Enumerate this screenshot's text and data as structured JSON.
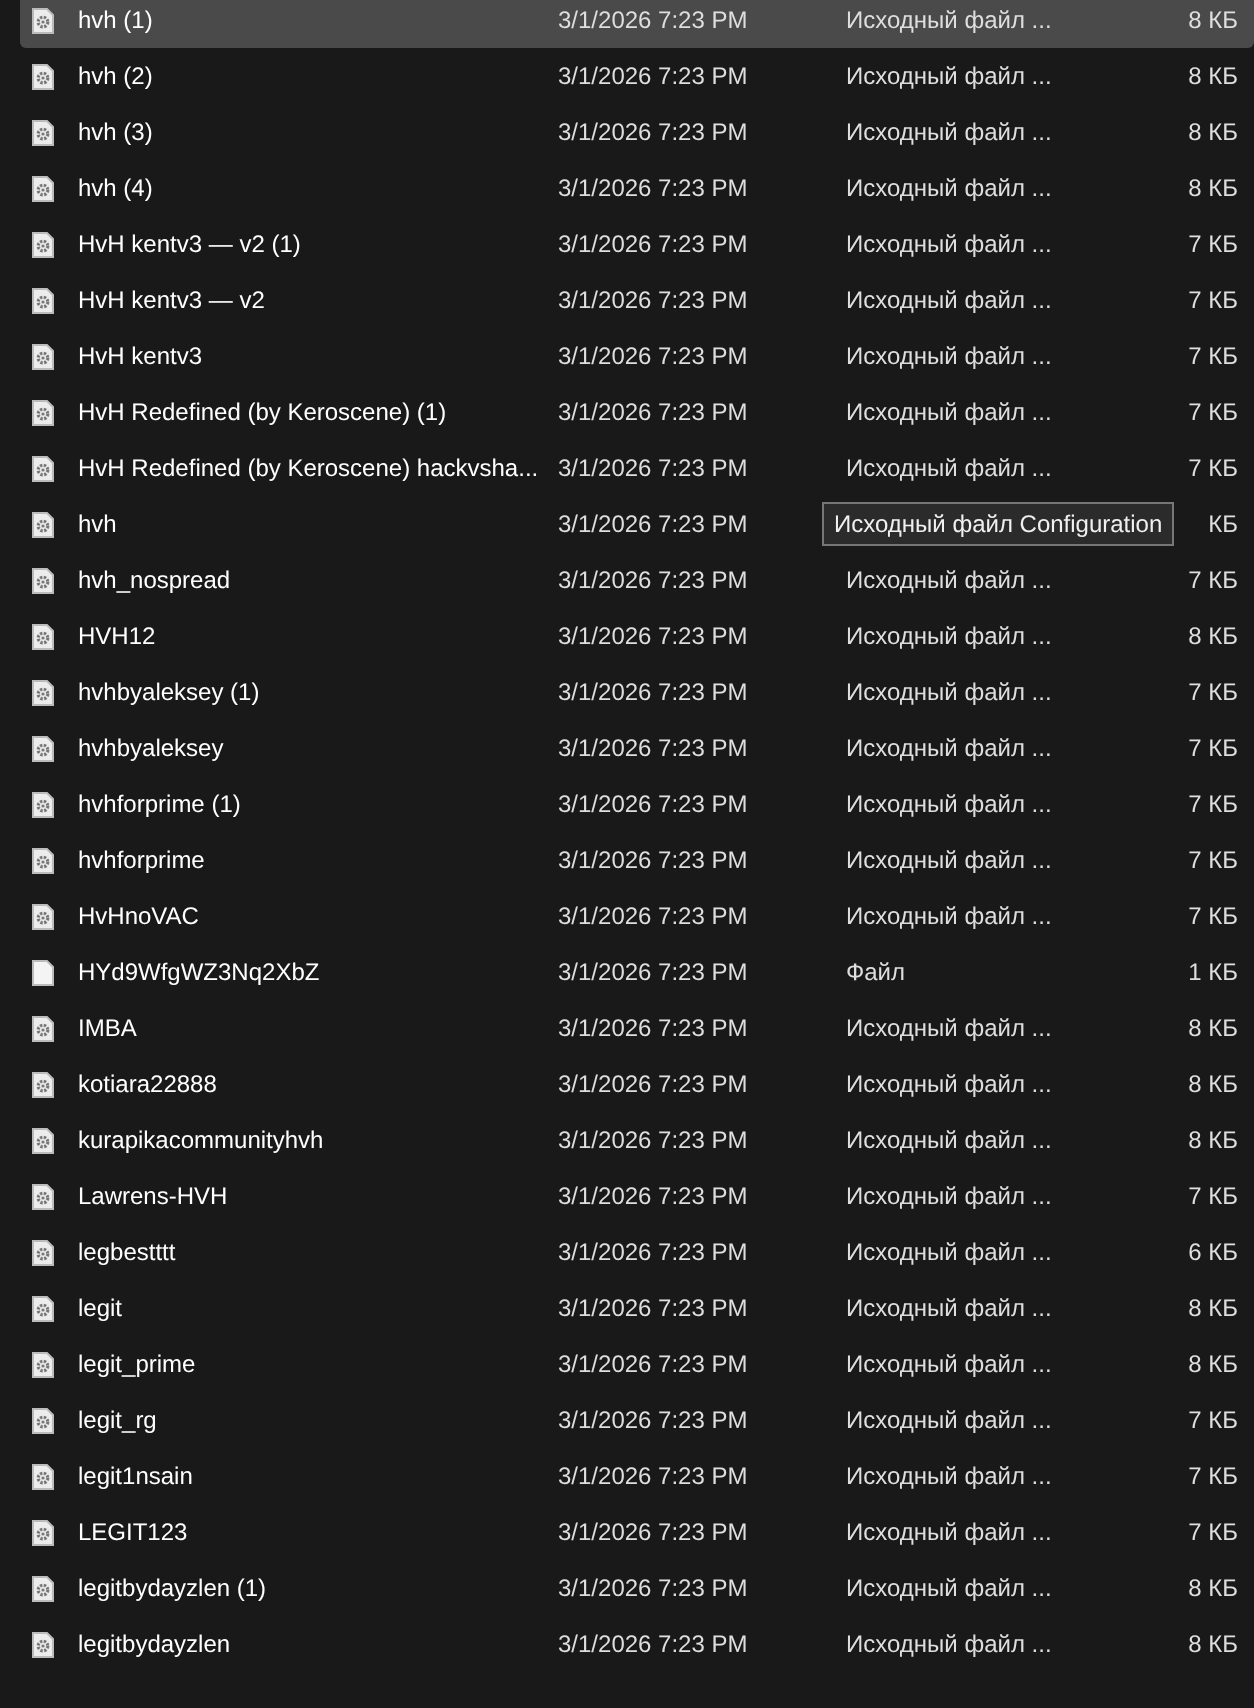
{
  "files": [
    {
      "kind": "config",
      "name": "hvh (1)",
      "date": "3/1/2026 7:23 PM",
      "type": "Исходный файл ...",
      "size": "8 КБ",
      "selected": true
    },
    {
      "kind": "config",
      "name": "hvh (2)",
      "date": "3/1/2026 7:23 PM",
      "type": "Исходный файл ...",
      "size": "8 КБ",
      "selected": false
    },
    {
      "kind": "config",
      "name": "hvh (3)",
      "date": "3/1/2026 7:23 PM",
      "type": "Исходный файл ...",
      "size": "8 КБ",
      "selected": false
    },
    {
      "kind": "config",
      "name": "hvh (4)",
      "date": "3/1/2026 7:23 PM",
      "type": "Исходный файл ...",
      "size": "8 КБ",
      "selected": false
    },
    {
      "kind": "config",
      "name": "HvH kentv3 — v2 (1)",
      "date": "3/1/2026 7:23 PM",
      "type": "Исходный файл ...",
      "size": "7 КБ",
      "selected": false
    },
    {
      "kind": "config",
      "name": "HvH kentv3 — v2",
      "date": "3/1/2026 7:23 PM",
      "type": "Исходный файл ...",
      "size": "7 КБ",
      "selected": false
    },
    {
      "kind": "config",
      "name": "HvH kentv3",
      "date": "3/1/2026 7:23 PM",
      "type": "Исходный файл ...",
      "size": "7 КБ",
      "selected": false
    },
    {
      "kind": "config",
      "name": "HvH Redefined (by Keroscene) (1)",
      "date": "3/1/2026 7:23 PM",
      "type": "Исходный файл ...",
      "size": "7 КБ",
      "selected": false
    },
    {
      "kind": "config",
      "name": "HvH Redefined (by Keroscene) hackvsha...",
      "date": "3/1/2026 7:23 PM",
      "type": "Исходный файл ...",
      "size": "7 КБ",
      "selected": false
    },
    {
      "kind": "config",
      "name": "hvh",
      "date": "3/1/2026 7:23 PM",
      "size": "КБ",
      "selected": false,
      "tooltip": "Исходный файл Configuration"
    },
    {
      "kind": "config",
      "name": "hvh_nospread",
      "date": "3/1/2026 7:23 PM",
      "type": "Исходный файл ...",
      "size": "7 КБ",
      "selected": false
    },
    {
      "kind": "config",
      "name": "HVH12",
      "date": "3/1/2026 7:23 PM",
      "type": "Исходный файл ...",
      "size": "8 КБ",
      "selected": false
    },
    {
      "kind": "config",
      "name": "hvhbyaleksey (1)",
      "date": "3/1/2026 7:23 PM",
      "type": "Исходный файл ...",
      "size": "7 КБ",
      "selected": false
    },
    {
      "kind": "config",
      "name": "hvhbyaleksey",
      "date": "3/1/2026 7:23 PM",
      "type": "Исходный файл ...",
      "size": "7 КБ",
      "selected": false
    },
    {
      "kind": "config",
      "name": "hvhforprime (1)",
      "date": "3/1/2026 7:23 PM",
      "type": "Исходный файл ...",
      "size": "7 КБ",
      "selected": false
    },
    {
      "kind": "config",
      "name": "hvhforprime",
      "date": "3/1/2026 7:23 PM",
      "type": "Исходный файл ...",
      "size": "7 КБ",
      "selected": false
    },
    {
      "kind": "config",
      "name": "HvHnoVAC",
      "date": "3/1/2026 7:23 PM",
      "type": "Исходный файл ...",
      "size": "7 КБ",
      "selected": false
    },
    {
      "kind": "file",
      "name": "HYd9WfgWZ3Nq2XbZ",
      "date": "3/1/2026 7:23 PM",
      "type": "Файл",
      "size": "1 КБ",
      "selected": false
    },
    {
      "kind": "config",
      "name": "IMBA",
      "date": "3/1/2026 7:23 PM",
      "type": "Исходный файл ...",
      "size": "8 КБ",
      "selected": false
    },
    {
      "kind": "config",
      "name": "kotiara22888",
      "date": "3/1/2026 7:23 PM",
      "type": "Исходный файл ...",
      "size": "8 КБ",
      "selected": false
    },
    {
      "kind": "config",
      "name": "kurapikacommunityhvh",
      "date": "3/1/2026 7:23 PM",
      "type": "Исходный файл ...",
      "size": "8 КБ",
      "selected": false
    },
    {
      "kind": "config",
      "name": "Lawrens-HVH",
      "date": "3/1/2026 7:23 PM",
      "type": "Исходный файл ...",
      "size": "7 КБ",
      "selected": false
    },
    {
      "kind": "config",
      "name": "legbestttt",
      "date": "3/1/2026 7:23 PM",
      "type": "Исходный файл ...",
      "size": "6 КБ",
      "selected": false
    },
    {
      "kind": "config",
      "name": "legit",
      "date": "3/1/2026 7:23 PM",
      "type": "Исходный файл ...",
      "size": "8 КБ",
      "selected": false
    },
    {
      "kind": "config",
      "name": "legit_prime",
      "date": "3/1/2026 7:23 PM",
      "type": "Исходный файл ...",
      "size": "8 КБ",
      "selected": false
    },
    {
      "kind": "config",
      "name": "legit_rg",
      "date": "3/1/2026 7:23 PM",
      "type": "Исходный файл ...",
      "size": "7 КБ",
      "selected": false
    },
    {
      "kind": "config",
      "name": "legit1nsain",
      "date": "3/1/2026 7:23 PM",
      "type": "Исходный файл ...",
      "size": "7 КБ",
      "selected": false
    },
    {
      "kind": "config",
      "name": "LEGIT123",
      "date": "3/1/2026 7:23 PM",
      "type": "Исходный файл ...",
      "size": "7 КБ",
      "selected": false
    },
    {
      "kind": "config",
      "name": "legitbydayzlen (1)",
      "date": "3/1/2026 7:23 PM",
      "type": "Исходный файл ...",
      "size": "8 КБ",
      "selected": false
    },
    {
      "kind": "config",
      "name": "legitbydayzlen",
      "date": "3/1/2026 7:23 PM",
      "type": "Исходный файл ...",
      "size": "8 КБ",
      "selected": false
    }
  ]
}
